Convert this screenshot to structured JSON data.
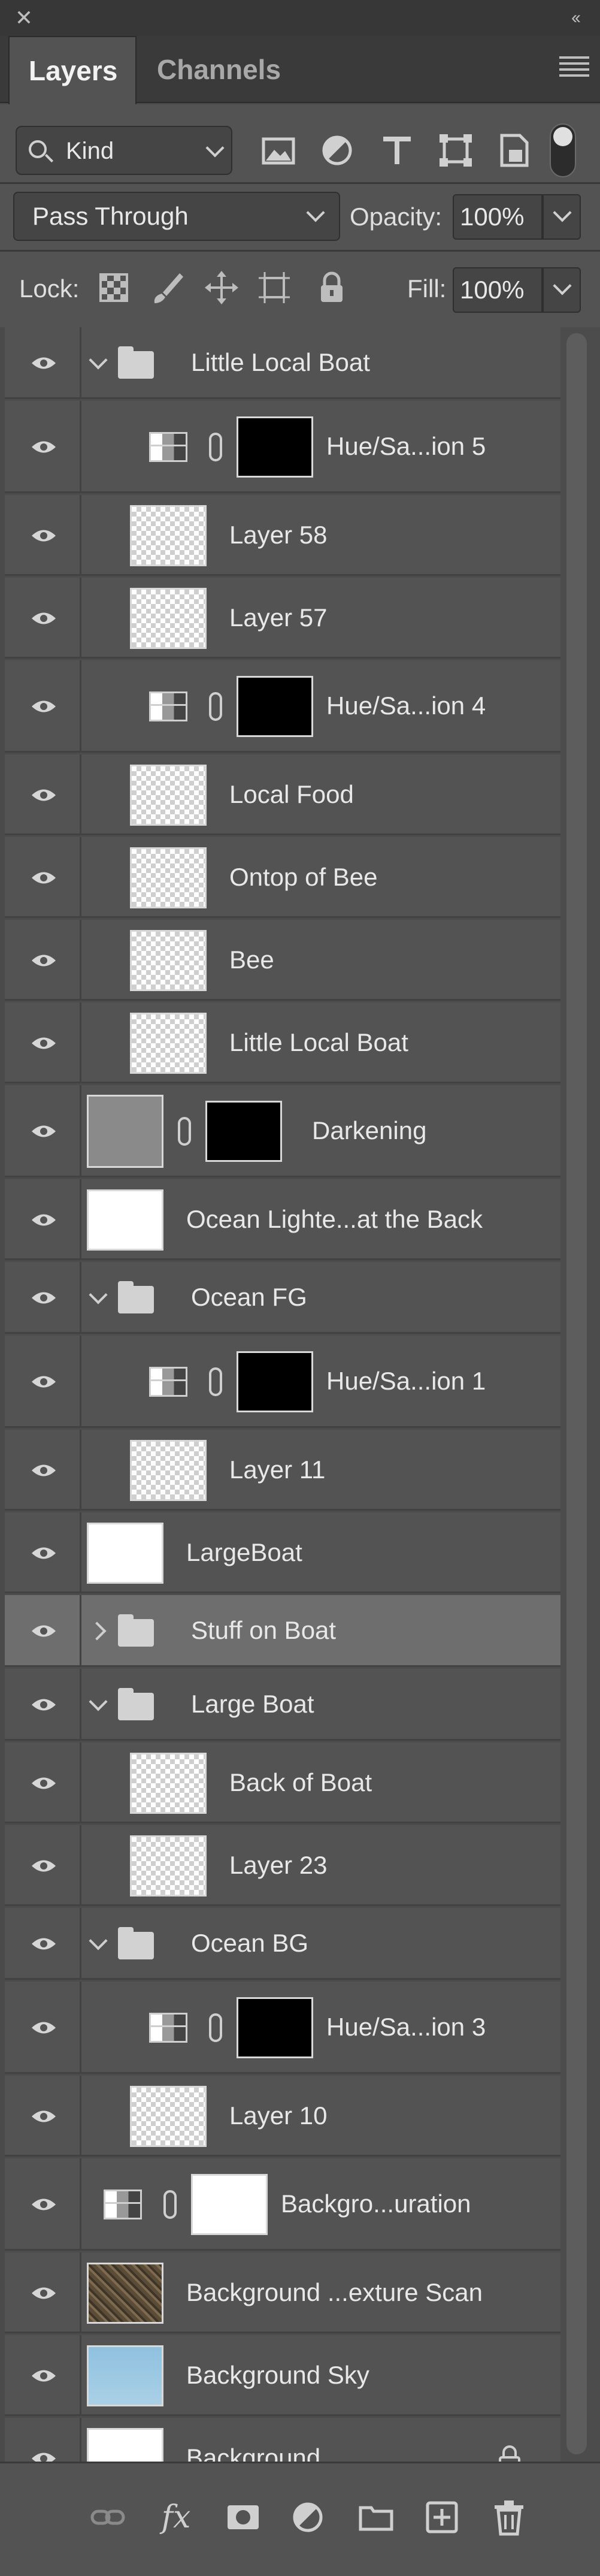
{
  "panel": {
    "close_glyph": "✕",
    "collapse_glyph": "‹‹"
  },
  "tabs": [
    {
      "label": "Layers",
      "active": true
    },
    {
      "label": "Channels",
      "active": false
    }
  ],
  "filter": {
    "kind_label": "Kind",
    "icons": [
      "image-filter-icon",
      "adjustment-filter-icon",
      "type-filter-icon",
      "shape-filter-icon",
      "smart-object-filter-icon"
    ]
  },
  "blend": {
    "mode": "Pass Through",
    "opacity_label": "Opacity:",
    "opacity_value": "100%"
  },
  "lock": {
    "label": "Lock:",
    "fill_label": "Fill:",
    "fill_value": "100%"
  },
  "layers": [
    {
      "name": "Little Local Boat",
      "type": "group-open"
    },
    {
      "name": "Hue/Sa...ion 5",
      "type": "adjustment"
    },
    {
      "name": "Layer 58",
      "type": "pixel"
    },
    {
      "name": "Layer 57",
      "type": "pixel"
    },
    {
      "name": "Hue/Sa...ion 4",
      "type": "adjustment"
    },
    {
      "name": "Local Food",
      "type": "pixel"
    },
    {
      "name": "Ontop of Bee",
      "type": "pixel"
    },
    {
      "name": "Bee",
      "type": "pixel"
    },
    {
      "name": "Little Local Boat",
      "type": "pixel"
    },
    {
      "name": "Darkening",
      "type": "levels-mask"
    },
    {
      "name": "Ocean Lighte...at the Back",
      "type": "pixel"
    },
    {
      "name": "Ocean FG",
      "type": "group-open"
    },
    {
      "name": "Hue/Sa...ion 1",
      "type": "adjustment"
    },
    {
      "name": "Layer 11",
      "type": "pixel"
    },
    {
      "name": "LargeBoat",
      "type": "pixel"
    },
    {
      "name": "Stuff on Boat",
      "type": "group-closed",
      "selected": true
    },
    {
      "name": "Large Boat",
      "type": "group-open"
    },
    {
      "name": "Back of Boat",
      "type": "pixel"
    },
    {
      "name": "Layer 23",
      "type": "pixel"
    },
    {
      "name": "Ocean BG",
      "type": "group-open"
    },
    {
      "name": "Hue/Sa...ion 3",
      "type": "adjustment"
    },
    {
      "name": "Layer 10",
      "type": "pixel"
    },
    {
      "name": "Backgro...uration",
      "type": "adjustment"
    },
    {
      "name": "Background ...exture Scan",
      "type": "pixel"
    },
    {
      "name": "Background Sky",
      "type": "pixel"
    },
    {
      "name": "Background",
      "type": "background-locked"
    }
  ],
  "footer": {
    "fx_label": "fx",
    "icons": [
      "link-layers-icon",
      "fx-icon",
      "add-mask-icon",
      "new-fill-adjustment-icon",
      "new-group-icon",
      "new-layer-icon",
      "delete-layer-icon"
    ]
  }
}
